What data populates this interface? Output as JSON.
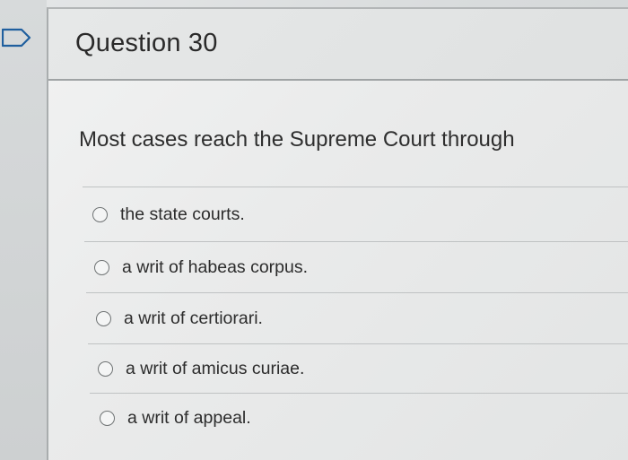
{
  "question": {
    "title": "Question 30",
    "prompt": "Most cases reach the Supreme Court through",
    "options": [
      {
        "label": "the state courts."
      },
      {
        "label": "a writ of habeas corpus."
      },
      {
        "label": "a writ of certiorari."
      },
      {
        "label": "a writ of amicus curiae."
      },
      {
        "label": "a writ of appeal."
      }
    ]
  },
  "icons": {
    "flag": "flag-question-icon"
  },
  "colors": {
    "text": "#2c2c2c",
    "radio_border": "#6f7374",
    "divider": "#bfc2c3",
    "card_border": "#a9adae"
  }
}
